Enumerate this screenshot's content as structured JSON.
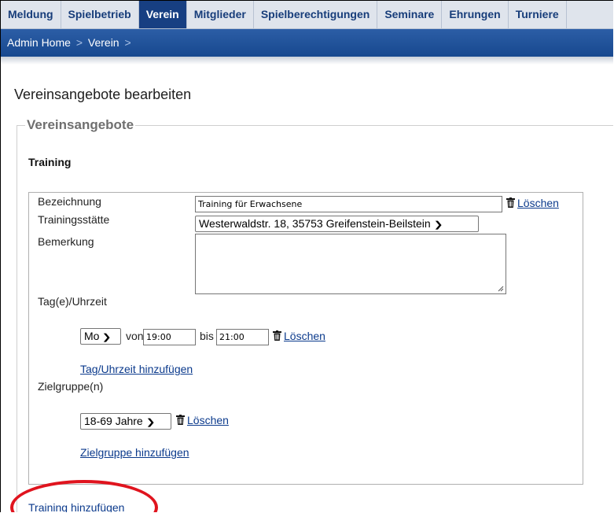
{
  "nav": {
    "tabs": [
      {
        "label": "Meldung",
        "active": false
      },
      {
        "label": "Spielbetrieb",
        "active": false
      },
      {
        "label": "Verein",
        "active": true
      },
      {
        "label": "Mitglieder",
        "active": false
      },
      {
        "label": "Spielberechtigungen",
        "active": false
      },
      {
        "label": "Seminare",
        "active": false
      },
      {
        "label": "Ehrungen",
        "active": false
      },
      {
        "label": "Turniere",
        "active": false
      }
    ]
  },
  "breadcrumb": {
    "home": "Admin Home",
    "sep": ">",
    "current": "Verein",
    "trailing_sep": ">"
  },
  "page": {
    "title": "Vereinsangebote bearbeiten"
  },
  "fieldset": {
    "legend": "Vereinsangebote"
  },
  "training": {
    "section_title": "Training",
    "bezeichnung_label": "Bezeichnung",
    "bezeichnung_value": "Training für Erwachsene",
    "delete_label": "Löschen",
    "trainingsstaette_label": "Trainingsstätte",
    "trainingsstaette_value": "Westerwaldstr. 18, 35753 Greifenstein-Beilstein",
    "bemerkung_label": "Bemerkung",
    "bemerkung_value": "",
    "tag_uhrzeit_label": "Tag(e)/Uhrzeit",
    "day_value": "Mo",
    "von_label": "von",
    "von_value": "19:00",
    "bis_label": "bis",
    "bis_value": "21:00",
    "add_tag_link": "Tag/Uhrzeit hinzufügen",
    "zielgruppe_label": "Zielgruppe(n)",
    "zielgruppe_value": "18-69 Jahre",
    "add_zielgruppe_link": "Zielgruppe hinzufügen"
  },
  "add_training_link": "Training hinzufügen",
  "colors": {
    "nav_active": "#173f82",
    "breadcrumb_bar": "#1f4f98",
    "link": "#0b3a8c",
    "highlight_circle": "#e0141e"
  },
  "icons": {
    "trash": "trash-icon",
    "dropdown": "chevron-down-icon",
    "resize": "resize-grip-icon"
  }
}
